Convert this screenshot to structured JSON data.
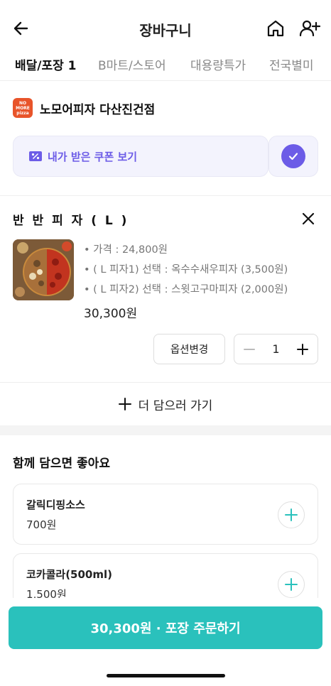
{
  "header": {
    "title": "장바구니"
  },
  "tabs": [
    {
      "label": "배달/포장 1",
      "active": true
    },
    {
      "label": "B마트/스토어",
      "active": false
    },
    {
      "label": "대용량특가",
      "active": false
    },
    {
      "label": "전국별미",
      "active": false
    }
  ],
  "store": {
    "name": "노모어피자 다산진건점",
    "logo_text": "NO MORE pizza",
    "logo_color": "#e8542a"
  },
  "coupon": {
    "label": "내가 받은 쿠폰 보기",
    "accent": "#6c5ce7",
    "checked": true
  },
  "cart_item": {
    "name": "반 반 피 자 ( L )",
    "options": [
      "• 가격 : 24,800원",
      "• ( L 피자1) 선택 : 옥수수새우피자 (3,500원)",
      "• ( L 피자2) 선택 : 스윗고구마피자 (2,000원)"
    ],
    "price": "30,300원",
    "option_change_label": "옵션변경",
    "quantity": "1"
  },
  "add_more_label": "더 담으러 가기",
  "recommendations": {
    "title": "함께 담으면 좋아요",
    "items": [
      {
        "name": "갈릭디핑소스",
        "price": "700원"
      },
      {
        "name": "코카콜라(500ml)",
        "price": "1,500원"
      }
    ]
  },
  "order_button": {
    "label": "30,300원 · 포장 주문하기",
    "color": "#2ac1bc"
  },
  "icons": [
    "back-arrow-icon",
    "home-icon",
    "user-plus-icon",
    "coupon-icon",
    "check-icon",
    "close-icon",
    "minus-icon",
    "plus-icon"
  ]
}
